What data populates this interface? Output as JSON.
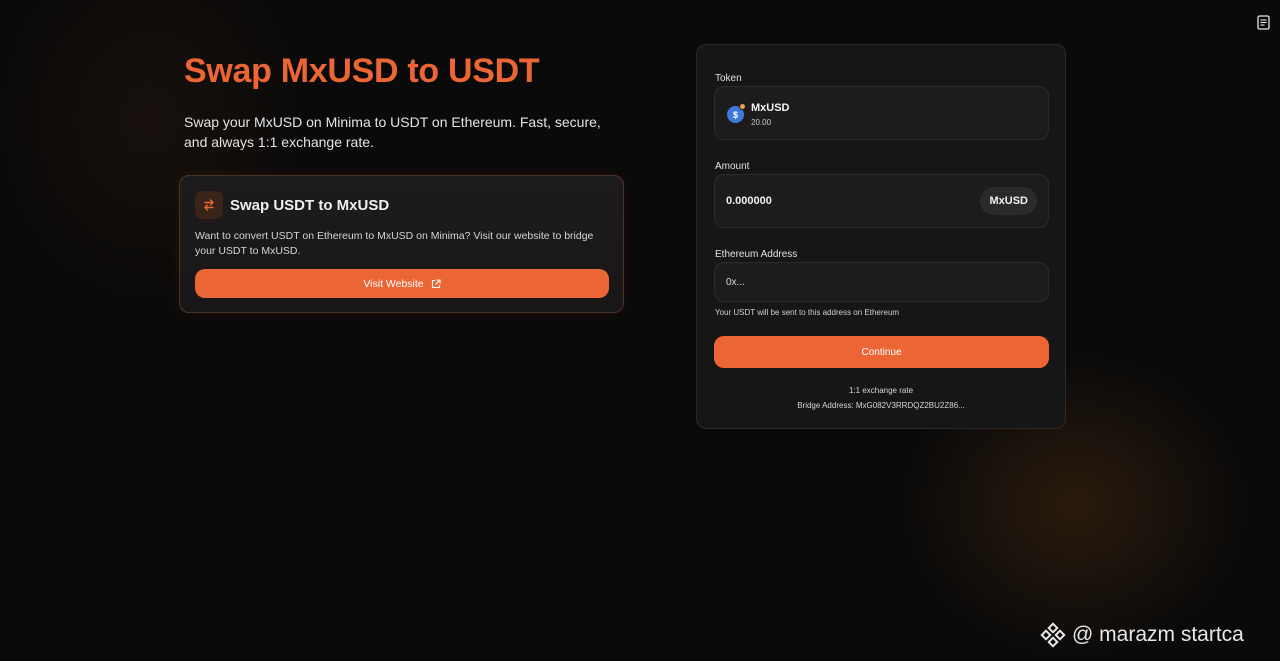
{
  "header": {
    "title": "Swap MxUSD to USDT",
    "subtitle": "Swap your MxUSD on Minima to USDT on Ethereum. Fast, secure, and always 1:1 exchange rate."
  },
  "top_icon": "document-icon",
  "promo": {
    "title": "Swap USDT to MxUSD",
    "text": "Want to convert USDT on Ethereum to MxUSD on Minima? Visit our website to bridge your USDT to MxUSD.",
    "button_label": "Visit Website",
    "icon": "swap-arrows-icon"
  },
  "form": {
    "token_label": "Token",
    "token": {
      "name": "MxUSD",
      "balance": "20.00",
      "logo_glyph": "$"
    },
    "amount_label": "Amount",
    "amount_value": "0.000000",
    "amount_unit": "MxUSD",
    "address_label": "Ethereum Address",
    "address_placeholder": "0x...",
    "address_hint": "Your USDT will be sent to this address on Ethereum",
    "continue_label": "Continue",
    "exchange_rate": "1:1 exchange rate",
    "bridge_address": "Bridge Address: MxG082V3RRDQZ2BU2Z86..."
  },
  "watermark": {
    "text": "@ marazm startca"
  },
  "colors": {
    "accent": "#ec6535",
    "background": "#0b0a0a",
    "card": "#171616"
  }
}
